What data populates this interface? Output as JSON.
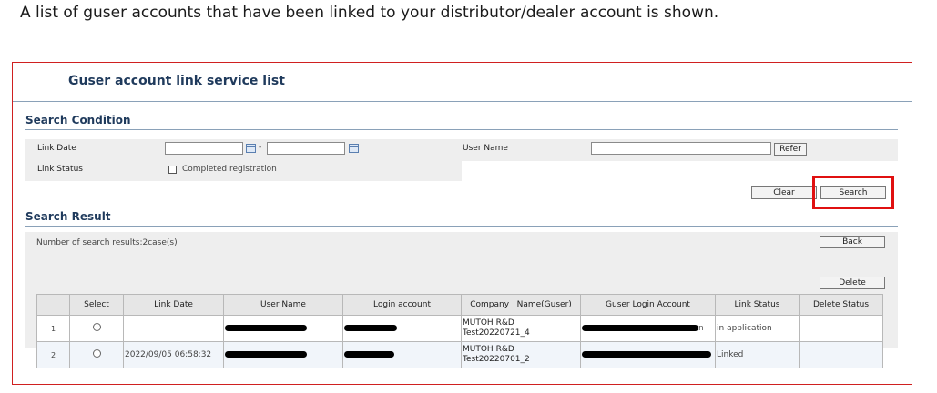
{
  "caption": "A list of guser accounts that have been linked to your distributor/dealer account is shown.",
  "panel": {
    "title": "Guser account link service list",
    "search_condition": {
      "heading": "Search Condition",
      "link_date_label": "Link Date",
      "date_separator": "-",
      "user_name_label": "User Name",
      "refer_label": "Refer",
      "link_status_label": "Link Status",
      "completed_label": "Completed registration",
      "clear_label": "Clear",
      "search_label": "Search"
    },
    "search_result": {
      "heading": "Search Result",
      "count_text": "Number of search results:2case(s)",
      "back_label": "Back",
      "delete_label": "Delete"
    },
    "table": {
      "headers": [
        "",
        "Select",
        "Link Date",
        "User Name",
        "Login account",
        "Company   Name(Guser)",
        "Guser Login Account",
        "Link Status",
        "Delete Status"
      ],
      "rows": [
        {
          "no": "1",
          "link_date": "",
          "company_line1": "MUTOH R&D",
          "company_line2": "Test20220721_4",
          "guser_suffix": "n",
          "link_status": "in application",
          "delete_status": ""
        },
        {
          "no": "2",
          "link_date": "2022/09/05 06:58:32",
          "company_line1": "MUTOH R&D",
          "company_line2": "Test20220701_2",
          "guser_suffix": "",
          "link_status": "Linked",
          "delete_status": ""
        }
      ]
    }
  },
  "icons": {
    "calendar": "calendar-icon",
    "radio": "radio-button",
    "checkbox": "checkbox"
  },
  "colors": {
    "highlight_border": "#e01010",
    "panel_border": "#d02020",
    "title": "#1f3a5c"
  }
}
